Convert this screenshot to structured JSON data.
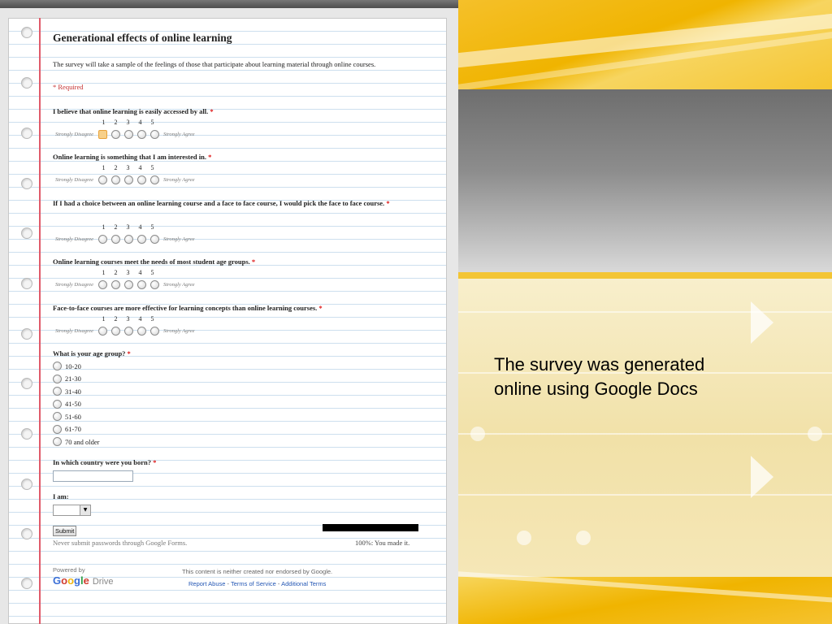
{
  "caption": {
    "line1": "The survey was generated",
    "line2": "online using Google Docs"
  },
  "form": {
    "title": "Generational effects of online learning",
    "description": "The survey will take a sample of the feelings of those that participate about learning material through online courses.",
    "required_note": "* Required",
    "required_star": "*",
    "scale": [
      "1",
      "2",
      "3",
      "4",
      "5"
    ],
    "low_label": "Strongly Disagree",
    "high_label": "Strongly Agree",
    "questions": [
      {
        "text": "I believe that online learning is easily accessed by all.",
        "selected": 1
      },
      {
        "text": "Online learning is something that I am interested in.",
        "selected": 0
      },
      {
        "text": "If I had a choice between an online learning course and a face to face course, I would pick the face to face course.",
        "selected": 0
      },
      {
        "text": "Online learning courses meet the needs of most student age groups.",
        "selected": 0
      },
      {
        "text": "Face-to-face courses are more effective for learning concepts than online learning courses.",
        "selected": 0
      }
    ],
    "age_question": "What is your age group?",
    "age_options": [
      "10-20",
      "21-30",
      "31-40",
      "41-50",
      "51-60",
      "61-70",
      "70 and older"
    ],
    "country_question": "In which country were you born?",
    "country_value": "",
    "iam_label": "I am:",
    "iam_value": "",
    "submit_label": "Submit",
    "never_note": "Never submit passwords through Google Forms.",
    "progress_text": "100%: You made it.",
    "progress": 1.0
  },
  "footer": {
    "powered_by": "Powered by",
    "logo_text": "Google",
    "drive_text": "Drive",
    "disclaimer": "This content is neither created nor endorsed by Google.",
    "links": [
      "Report Abuse",
      "Terms of Service",
      "Additional Terms"
    ]
  },
  "colors": {
    "margin_line": "#e05a6a",
    "rule_line": "#cde0ee",
    "required": "#c53030",
    "link": "#2457b4",
    "slide_yellow": "#f0b400"
  }
}
